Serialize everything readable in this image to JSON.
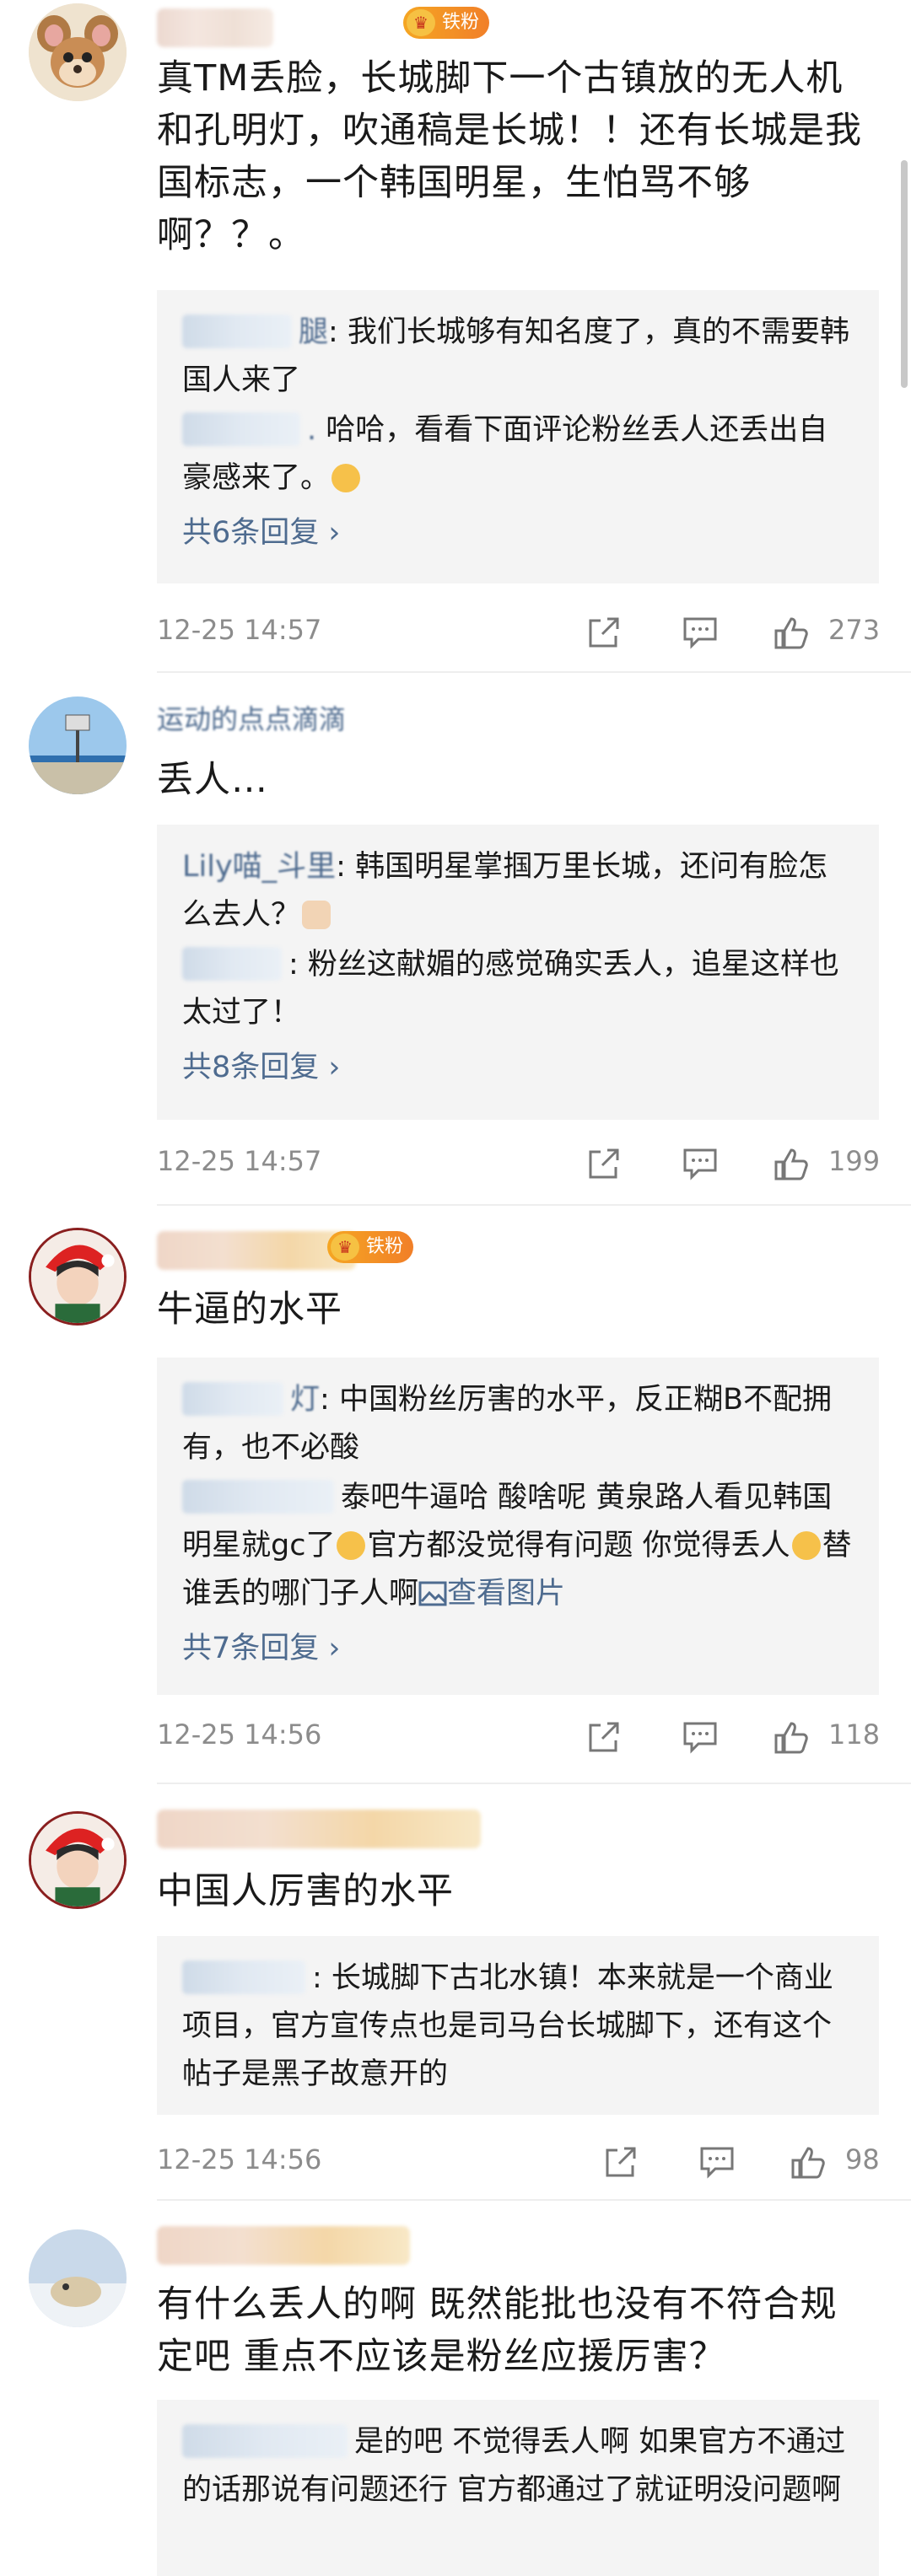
{
  "comments": [
    {
      "text": "真TM丢脸，长城脚下一个古镇放的无人机和孔明灯，吹通稿是长城！！还有长城是我国标志，一个韩国明星，生怕骂不够啊？？。",
      "badge": "铁粉",
      "replies": [
        {
          "name": "腿",
          "text": "我们长城够有知名度了，真的不需要韩国人来了"
        },
        {
          "name": ".",
          "text": "哈哈，看看下面评论粉丝丢人还丢出自豪感来了。"
        }
      ],
      "more": "共6条回复 ›",
      "time": "12-25 14:57",
      "likes": "273"
    },
    {
      "username": "运动的点点滴滴",
      "text": "丢人…",
      "replies": [
        {
          "name": "Lily喵_斗里",
          "text": "韩国明星掌掴万里长城，还问有脸怎么去人？"
        },
        {
          "name": "",
          "text": "粉丝这献媚的感觉确实丢人，追星这样也太过了！"
        }
      ],
      "more": "共8条回复 ›",
      "time": "12-25 14:57",
      "likes": "199"
    },
    {
      "text": "牛逼的水平",
      "badge": "铁粉",
      "replies": [
        {
          "name": "灯",
          "text": "中国粉丝厉害的水平，反正糊B不配拥有，也不必酸"
        },
        {
          "name": "",
          "text_a": "泰吧牛逼哈 酸啥呢 黄泉路人看见韩国明星就gc了",
          "text_b": "官方都没觉得有问题 你觉得丢人",
          "text_c": "替谁丢的哪门子人啊",
          "img_link": "查看图片"
        }
      ],
      "more": "共7条回复 ›",
      "time": "12-25 14:56",
      "likes": "118"
    },
    {
      "text": "中国人厉害的水平",
      "replies": [
        {
          "name": "",
          "text": "长城脚下古北水镇！本来就是一个商业项目，官方宣传点也是司马台长城脚下，还有这个帖子是黑子故意开的"
        }
      ],
      "time": "12-25 14:56",
      "likes": "98"
    },
    {
      "text": "有什么丢人的啊 既然能批也没有不符合规定吧 重点不应该是粉丝应援厉害？",
      "replies": [
        {
          "name": "",
          "text": "是的吧 不觉得丢人啊 如果官方不通过的话那说有问题还行 官方都通过了就证明没问题啊"
        }
      ]
    }
  ]
}
